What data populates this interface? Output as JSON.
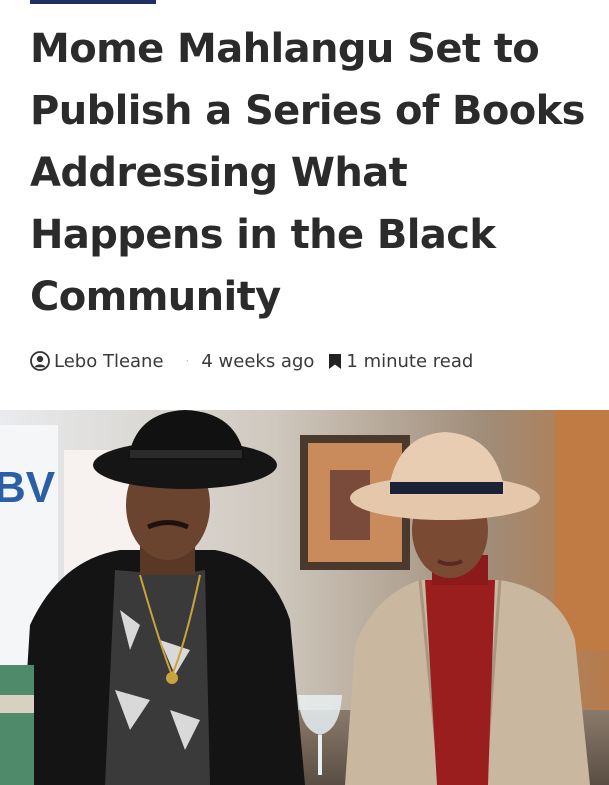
{
  "article": {
    "title": "Mome Mahlangu Set to Publish a Series of Books Addressing What Happens in the Black Community"
  },
  "meta": {
    "author": "Lebo Tleane",
    "separator": "·",
    "date": "4 weeks ago",
    "read_time": "1 minute read",
    "icons": [
      "user-circle-icon",
      "bookmark-icon"
    ]
  },
  "photo": {
    "backdrop_text": "BV"
  }
}
